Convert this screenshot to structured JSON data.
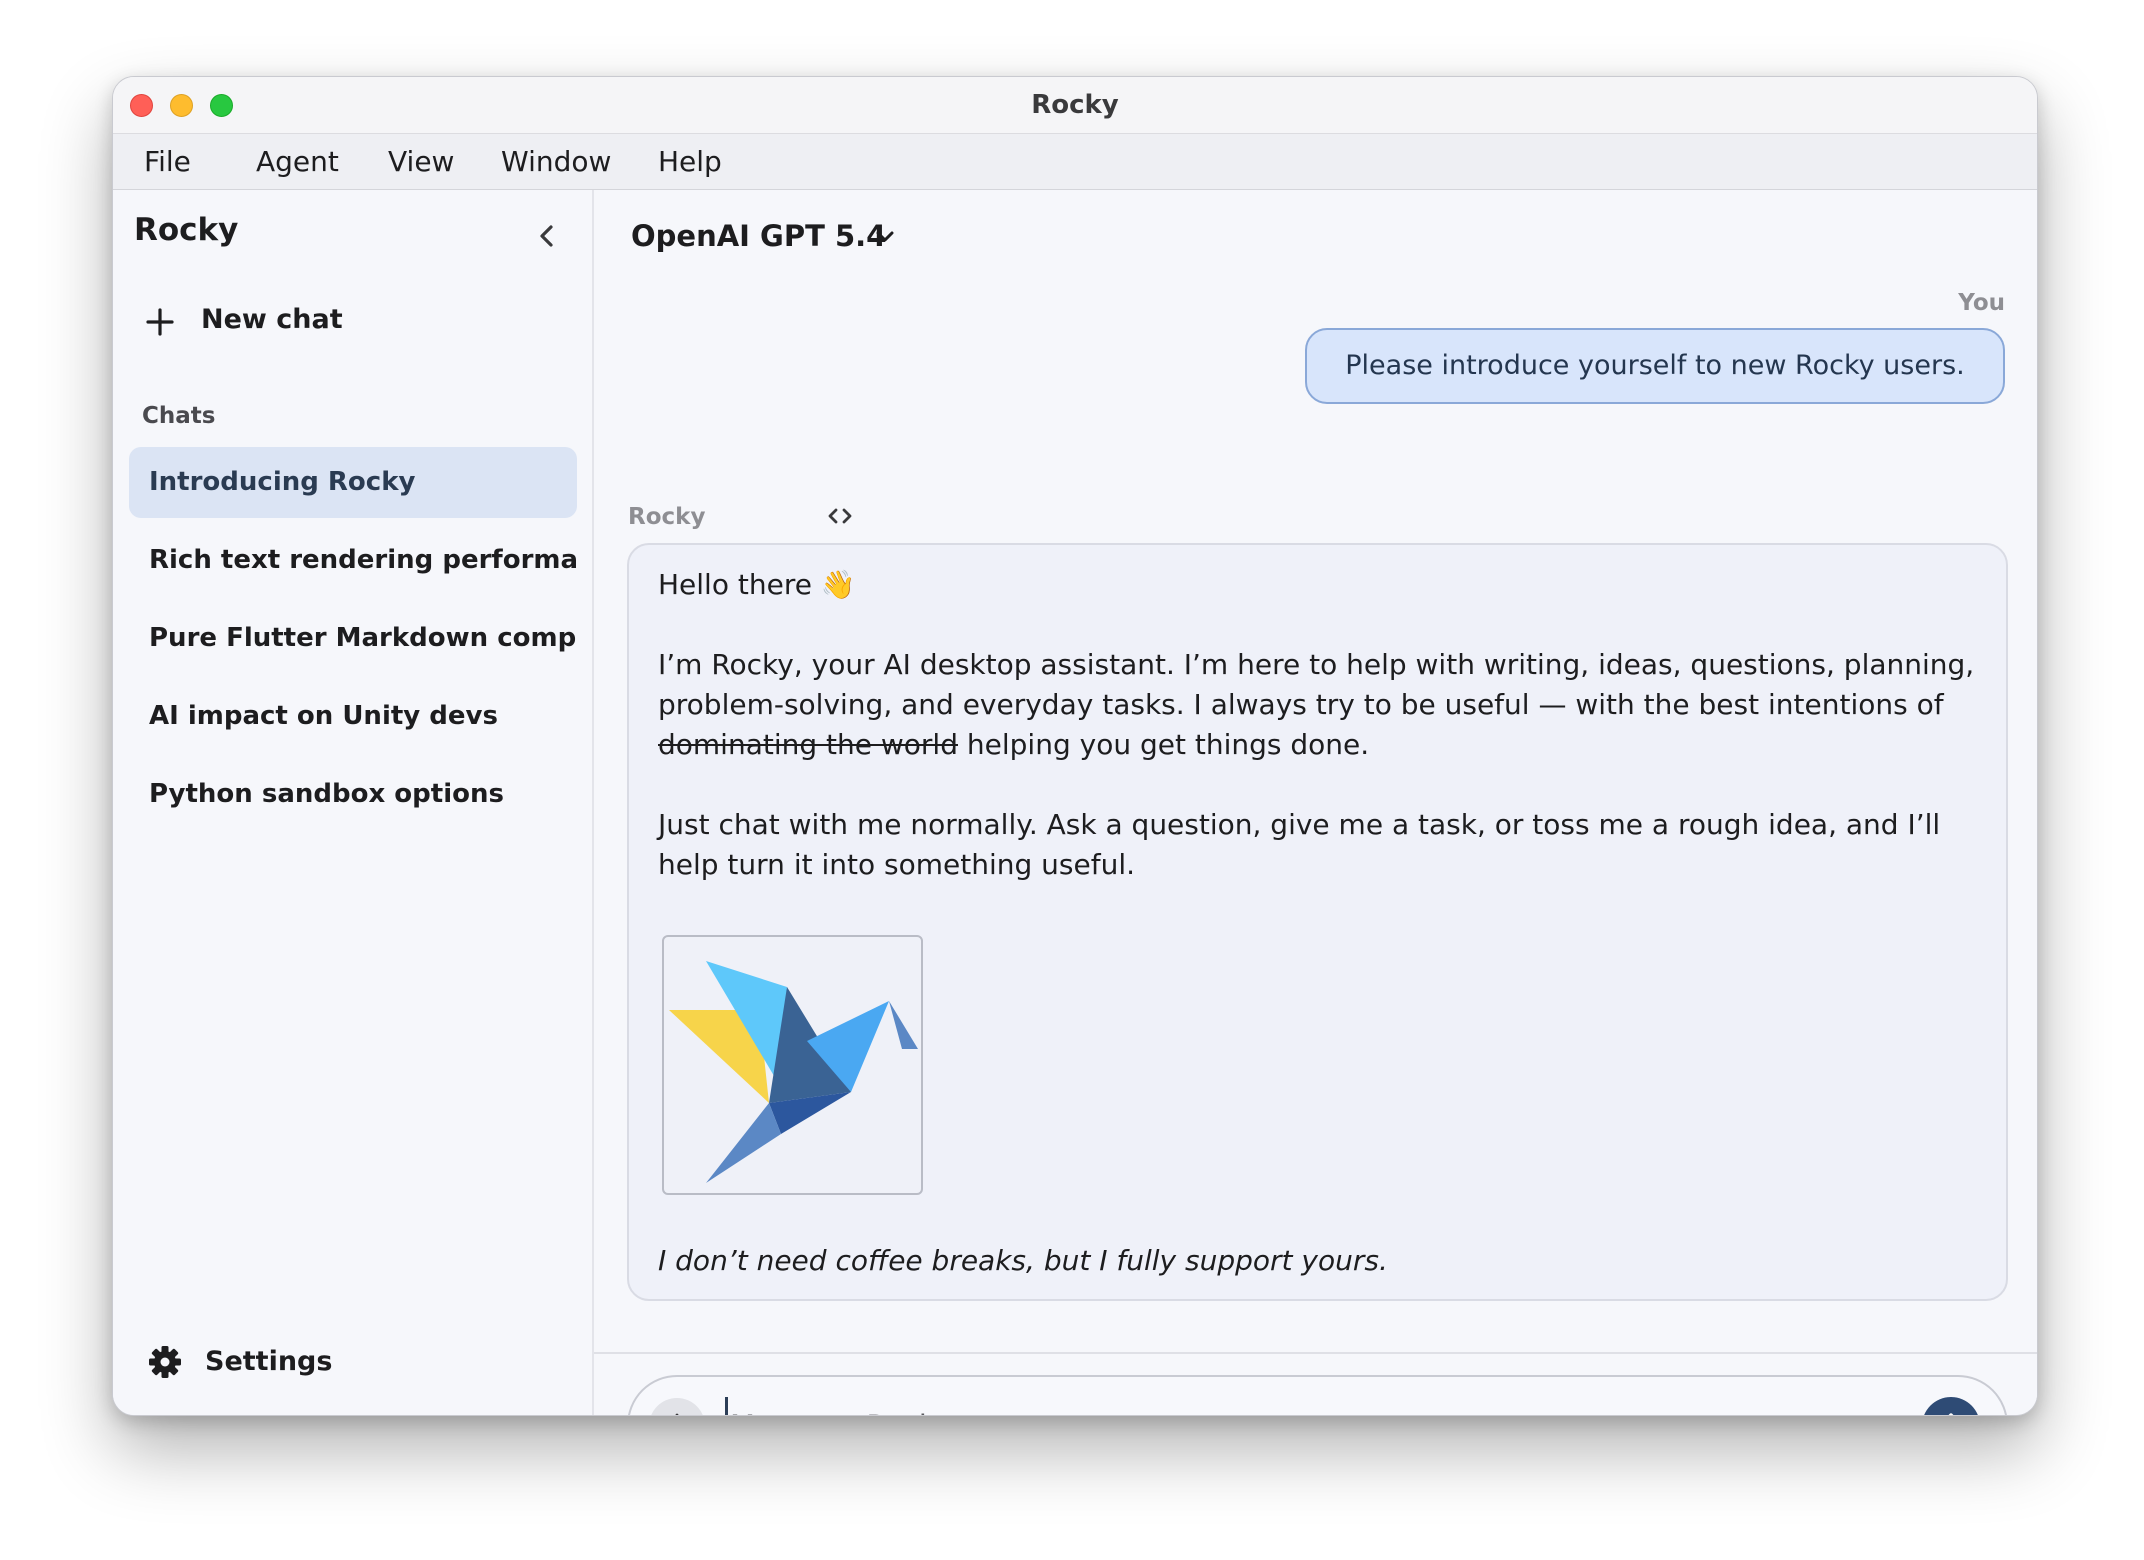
{
  "window": {
    "title": "Rocky"
  },
  "menu": [
    "File",
    "Agent",
    "View",
    "Window",
    "Help"
  ],
  "sidebar": {
    "title": "Rocky",
    "new_chat_label": "New chat",
    "section_label": "Chats",
    "chats": [
      {
        "label": "Introducing Rocky",
        "active": true
      },
      {
        "label": "Rich text rendering performa...",
        "active": false
      },
      {
        "label": "Pure Flutter Markdown compl...",
        "active": false
      },
      {
        "label": "AI impact on Unity devs",
        "active": false
      },
      {
        "label": "Python sandbox options",
        "active": false
      }
    ],
    "settings_label": "Settings"
  },
  "main": {
    "model_label": "OpenAI GPT 5.4",
    "user": {
      "label": "You",
      "message": "Please introduce yourself to new Rocky users."
    },
    "assistant": {
      "label": "Rocky",
      "greeting": "Hello there",
      "greeting_emoji": "👋",
      "para1_before_strike": "I’m Rocky, your AI desktop assistant. I’m here to help with writing, ideas, questions, planning, problem-solving, and everyday tasks. I always try to be useful — with the best intentions of ",
      "para1_strike": "dominating the world",
      "para1_after_strike": " helping you get things done.",
      "para2": "Just chat with me normally. Ask a question, give me a task, or toss me a rough idea, and I’ll help turn it into something useful.",
      "footer": "I don’t need coffee breaks, but I fully support yours."
    },
    "composer": {
      "placeholder": "Message Rocky"
    }
  },
  "colors": {
    "accent": "#2e4b75",
    "user_bubble": "#d8e5fb",
    "active_chat": "#dbe4f4",
    "logo_yellow": "#f7d44a",
    "logo_sky": "#5ec8fa",
    "logo_blue": "#4aa8f2",
    "logo_navy": "#2c579e"
  }
}
